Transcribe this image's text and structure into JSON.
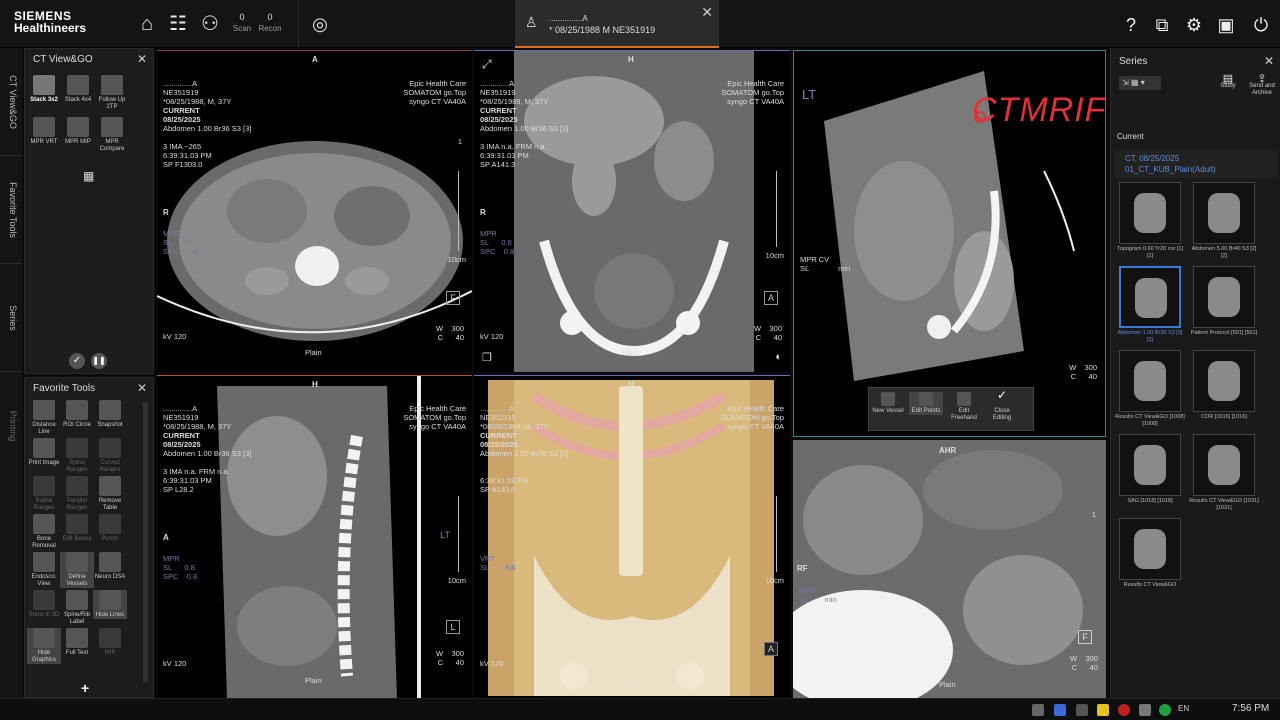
{
  "brand": {
    "line1": "SIEMENS",
    "line2": "Healthineers"
  },
  "topbar": {
    "scan_count": "0",
    "scan_label": "Scan",
    "recon_count": "0",
    "recon_label": "Recon",
    "patient_name": "...............A",
    "patient_info": "* 08/25/1988 M NE351919"
  },
  "leftrail": {
    "items": [
      "CT View&GO",
      "Favorite Tools",
      "Series",
      "Printing"
    ]
  },
  "ct_view_go": {
    "title": "CT View&GO",
    "layouts": [
      "Stack 3x2",
      "Stack 4x4",
      "Follow Up 2TP",
      "MPR VRT",
      "MPR MIP",
      "MPR Compare"
    ]
  },
  "favorite_tools": {
    "title": "Favorite Tools",
    "tools": [
      "Distance Line",
      "ROI Circle",
      "Snapshot",
      "Print Image",
      "Spine Ranges",
      "Curved Ranges",
      "Radial Ranges",
      "Parallel Ranges",
      "Remove Table",
      "Bone Removal",
      "Edit Bones",
      "Punch",
      "Endosco. View",
      "Define Vessels",
      "Neuro DSA",
      "Show in 3D",
      "Spine/Rib Label",
      "Hide Lines",
      "Hide Graphics",
      "Full Text",
      "MIP"
    ],
    "add_label": "+"
  },
  "vp_common": {
    "pname": "..............A",
    "pid": "NE351919",
    "dob": "*08/25/1988, M, 37Y",
    "current": "CURRENT",
    "date": "08/25/2025",
    "inst": "Epic Health Care",
    "scanner": "SOMATOM go.Top",
    "sw": "syngo CT VA40A",
    "kv": "kV 120",
    "plain": "Plain",
    "w_label": "W",
    "w_val": "300",
    "c_label": "C",
    "c_val": "40",
    "mpr": "MPR",
    "sl": "SL",
    "spc": "SPC",
    "sl_val": "0.8",
    "spc_val": "0.8",
    "scale": "10cm",
    "series": "Abdomen 1.00 Br36 S3 [3]"
  },
  "vp1": {
    "top": "A",
    "left": "R",
    "ima": "3 IMA ~265",
    "time": "6:39:31.03 PM",
    "pos": "SP F1303.0",
    "one": "1"
  },
  "vp2": {
    "top": "H",
    "left": "R",
    "ima": "3 IMA n.a. FRM n.a.",
    "time": "6:39:31.03 PM",
    "pos": "SP A141.3",
    "orient_box": "A"
  },
  "vp3": {
    "corner": "LT",
    "label": "MPR CV",
    "sl": "SL",
    "sl_val": "min",
    "w_val": "300",
    "c_val": "40",
    "watermark": "CTMRIFB",
    "vessel_tools": [
      "New Vessel",
      "Edit Points",
      "Edit Freehand",
      "Close Editing"
    ]
  },
  "vp4": {
    "top": "H",
    "left": "A",
    "ima": "3 IMA n.a. FRM n.a.",
    "time": "6:39:31.03 PM",
    "pos": "SP L28.2",
    "corner": "LT",
    "orient_box": "L"
  },
  "vp5": {
    "top": "H",
    "time": "6:39:31.03 PM",
    "pos": "SP A133.0",
    "vrt": "VRT",
    "sl": "SL",
    "sl_val": "full",
    "orient_box": "A"
  },
  "vp6": {
    "top": "AHR",
    "left": "RF",
    "mpr": "MPR",
    "sl": "SL",
    "sl_val": "min",
    "w_val": "300",
    "c_val": "40",
    "one": "1"
  },
  "series_panel": {
    "title": "Series",
    "study_btn": "Study",
    "send_btn": "Send and Archive",
    "current": "Current",
    "study_line1": "CT, 08/25/2025",
    "study_line2": "01_CT_KUB_Plain(Adult)",
    "thumbs": [
      "Topogram 0.60 Tr20 cor [1] [1]",
      "Abdomen 5.00 Br40 S3 [2] [2]",
      "Abdomen 1.00 Br36 S3 [3] [3]",
      "Patient Protocol [501] [501]",
      "Results CT View&GO [1008] [1008]",
      "COR [1016] [1016]",
      "SAG [1018] [1018]",
      "Results CT View&GO [1031] [1031]",
      "Results CT View&GO"
    ]
  },
  "taskbar": {
    "lang": "EN",
    "time": "7:56 PM"
  }
}
